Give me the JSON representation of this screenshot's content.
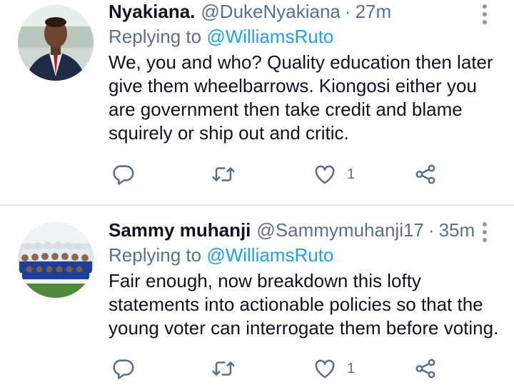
{
  "tweets": [
    {
      "name": "Nyakiana.",
      "handle": "@DukeNyakiana",
      "separator": "·",
      "time": "27m",
      "replying_prefix": "Replying to ",
      "replying_to": "@WilliamsRuto",
      "text": "We, you and who? Quality education then later give them wheelbarrows. Kiongosi either you are government then take credit and blame squirely or ship out and critic.",
      "likes": "1",
      "icons": [
        "reply-icon",
        "retweet-icon",
        "like-icon",
        "share-icon",
        "more-icon"
      ]
    },
    {
      "name": "Sammy muhanji",
      "handle": "@Sammymuhanji17",
      "separator": "·",
      "time": "35m",
      "replying_prefix": "Replying to ",
      "replying_to": "@WilliamsRuto",
      "text": "Fair enough, now breakdown this lofty statements into actionable policies so that the young voter can interrogate them before voting.",
      "likes": "1",
      "icons": [
        "reply-icon",
        "retweet-icon",
        "like-icon",
        "share-icon",
        "more-icon"
      ]
    }
  ],
  "colors": {
    "text": "#0f1419",
    "secondary": "#5b7083",
    "accent": "#1da1f2",
    "divider": "#e3e6e8",
    "icon": "#5b7083"
  }
}
